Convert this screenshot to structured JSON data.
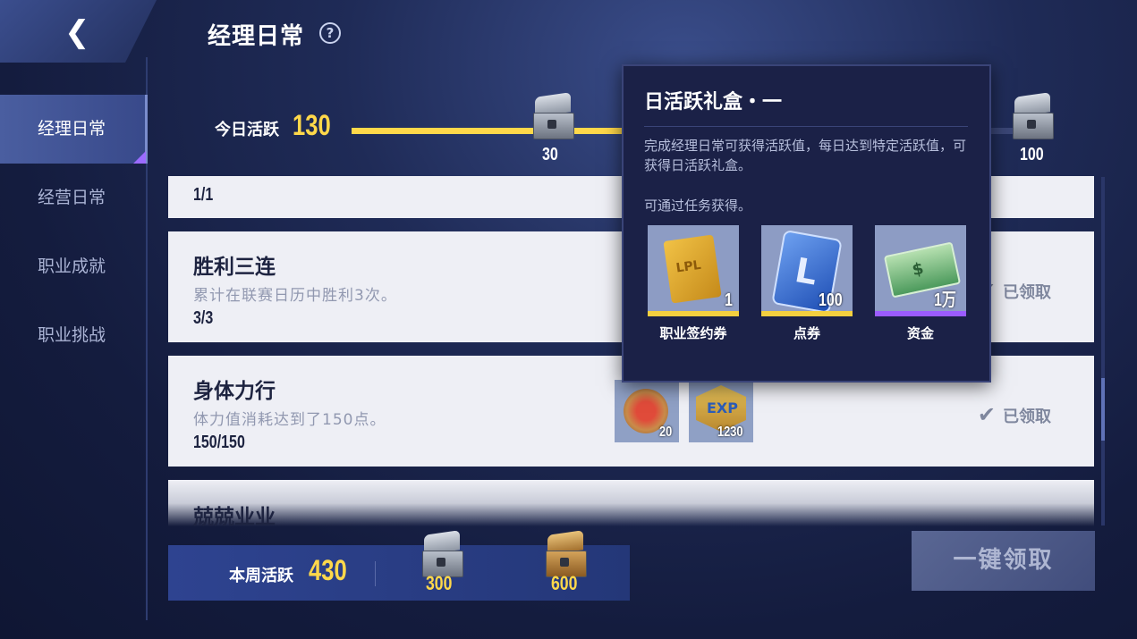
{
  "header": {
    "back_icon": "chevron-left-icon",
    "title": "经理日常",
    "help_icon": "question-circle-icon"
  },
  "sidebar": {
    "items": [
      {
        "label": "经理日常",
        "active": true
      },
      {
        "label": "经营日常",
        "active": false
      },
      {
        "label": "职业成就",
        "active": false
      },
      {
        "label": "职业挑战",
        "active": false
      }
    ]
  },
  "daily": {
    "label": "今日活跃",
    "value": "130",
    "progress_fraction": 0.45,
    "milestones": [
      {
        "num": "30"
      },
      {
        "num": "100"
      }
    ]
  },
  "tasks": [
    {
      "progress": "1/1"
    },
    {
      "name": "胜利三连",
      "desc": "累计在联赛日历中胜利3次。",
      "progress": "3/3",
      "status": "已领取"
    },
    {
      "name": "身体力行",
      "desc": "体力值消耗达到了150点。",
      "progress": "150/150",
      "status": "已领取",
      "rewards": [
        {
          "icon": "stamina-badge-icon",
          "qty": "20"
        },
        {
          "icon": "exp-badge-icon",
          "badge_text": "EXP",
          "qty": "1230"
        }
      ]
    },
    {
      "name": "兢兢业业"
    }
  ],
  "weekly": {
    "label": "本周活跃",
    "value": "430",
    "milestones": [
      {
        "num": "300"
      },
      {
        "num": "600"
      }
    ]
  },
  "claim_all": "一键领取",
  "popup": {
    "title": "日活跃礼盒・一",
    "desc": "完成经理日常可获得活跃值，每日达到特定活跃值，可获得日活跃礼盒。",
    "sub": "可通过任务获得。",
    "items": [
      {
        "label": "职业签约券",
        "qty": "1",
        "icon": "contract-ticket-icon",
        "icon_text": "LPL",
        "bar_color": "#f4d03f"
      },
      {
        "label": "点券",
        "qty": "100",
        "icon": "coupon-icon",
        "icon_text": "L",
        "bar_color": "#f4d03f"
      },
      {
        "label": "资金",
        "qty": "1万",
        "icon": "cash-icon",
        "icon_text": "$",
        "bar_color": "#9b5cff"
      }
    ]
  },
  "colors": {
    "accent": "#ffd84a",
    "panel": "#1b2147"
  }
}
